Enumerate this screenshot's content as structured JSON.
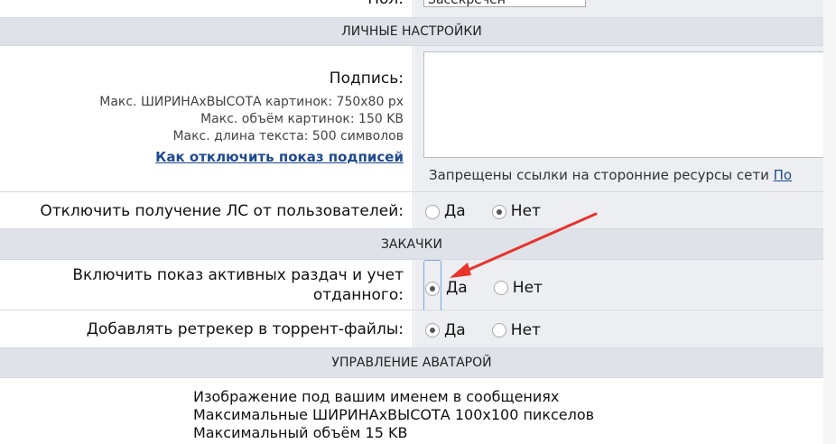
{
  "top_field": {
    "label": "Пол:",
    "value": "Засекречен"
  },
  "personal": {
    "header": "ЛИЧНЫЕ НАСТРОЙКИ",
    "signature": {
      "label": "Подпись:",
      "limits": [
        "Макс. ШИРИНАхВЫСОТА картинок: 750x80 px",
        "Макс. объём картинок: 150 KB",
        "Макс. длина текста: 500 символов"
      ],
      "help_link": "Как отключить показ подписей",
      "note": "Запрещены ссылки на сторонние ресурсы сети",
      "note_link": "По"
    },
    "disable_pm": {
      "label": "Отключить получение ЛС от пользователей:",
      "options": [
        "Да",
        "Нет"
      ],
      "selected": 1
    }
  },
  "downloads": {
    "header": "ЗАКАЧКИ",
    "show_active": {
      "label_line1": "Включить показ активных раздач и учет",
      "label_line2": "отданного:",
      "options": [
        "Да",
        "Нет"
      ],
      "selected": 0
    },
    "add_retracker": {
      "label": "Добавлять ретрекер в торрент-файлы:",
      "options": [
        "Да",
        "Нет"
      ],
      "selected": 0
    }
  },
  "avatar": {
    "header": "УПРАВЛЕНИЕ АВАТАРОЙ",
    "lines": [
      "Изображение под вашим именем в сообщениях",
      "Максимальные ШИРИНАхВЫСОТА 100x100 пикселов",
      "Максимальный объём 15 KB"
    ]
  },
  "annotation": {
    "color": "#e8322b"
  }
}
